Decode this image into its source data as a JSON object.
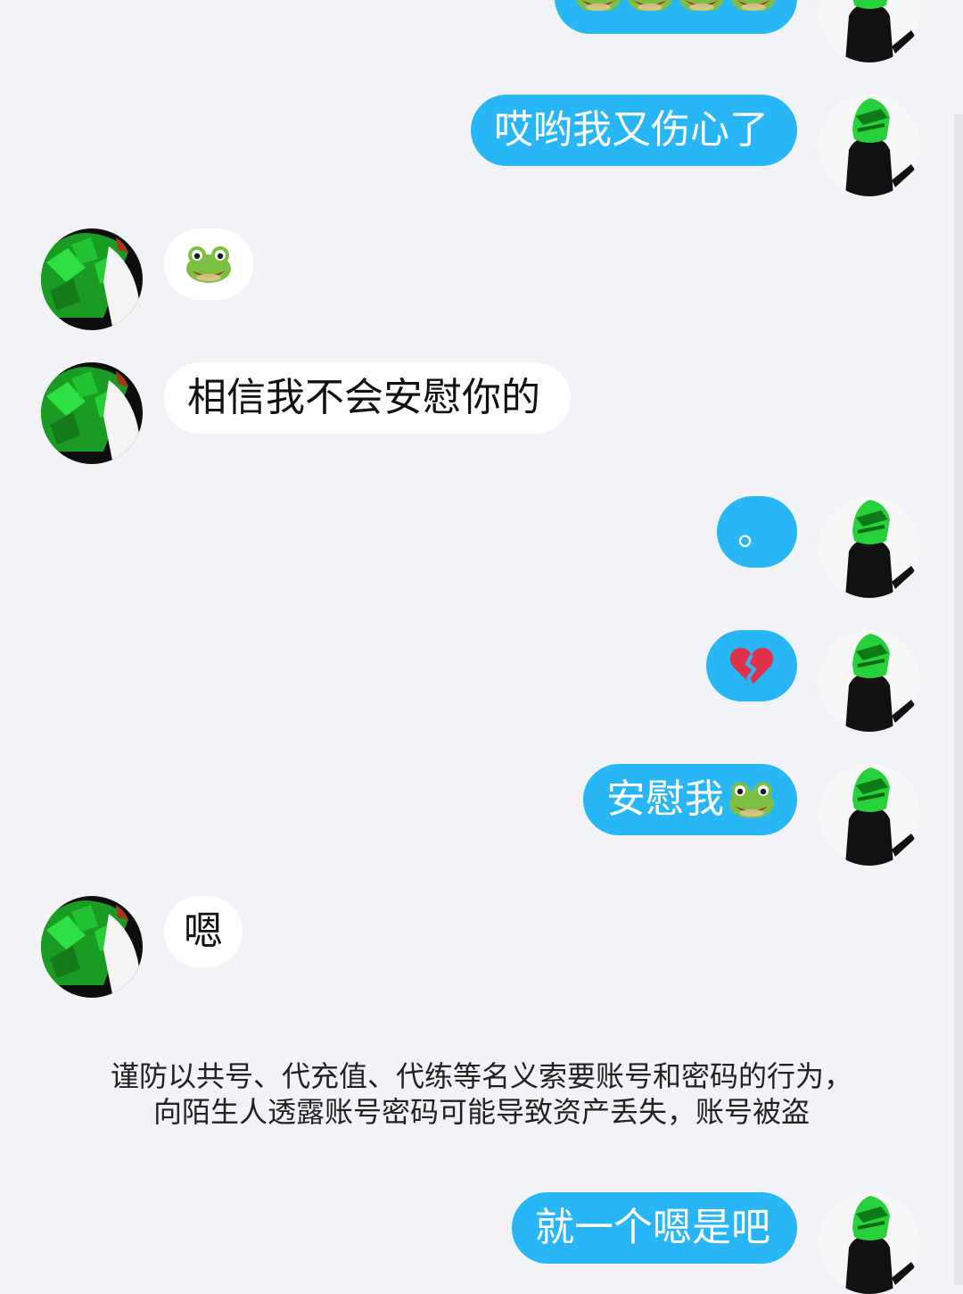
{
  "messages": {
    "m1": {
      "text": "",
      "icon": "frog-emoji x4",
      "side": "out"
    },
    "m2": {
      "text": "哎哟我又伤心了",
      "side": "out"
    },
    "m3": {
      "text": "",
      "icon": "frog-emoji",
      "side": "in"
    },
    "m4": {
      "text": "相信我不会安慰你的",
      "side": "in"
    },
    "m5": {
      "text": "。",
      "side": "out"
    },
    "m6": {
      "text": "",
      "icon": "broken-heart-emoji",
      "side": "out"
    },
    "m7": {
      "text": "安慰我",
      "icon": "frog-emoji",
      "side": "out"
    },
    "m8": {
      "text": "嗯",
      "side": "in"
    },
    "m9": {
      "text": "就一个嗯是吧",
      "side": "out"
    }
  },
  "security_notice": {
    "line1": "谨防以共号、代充值、代练等名义索要账号和密码的行为，",
    "line2": "向陌生人透露账号密码可能导致资产丢失，账号被盗"
  },
  "colors": {
    "background": "#f2f3f7",
    "outgoing_bubble": "#29b6f6",
    "incoming_bubble": "#ffffff"
  }
}
